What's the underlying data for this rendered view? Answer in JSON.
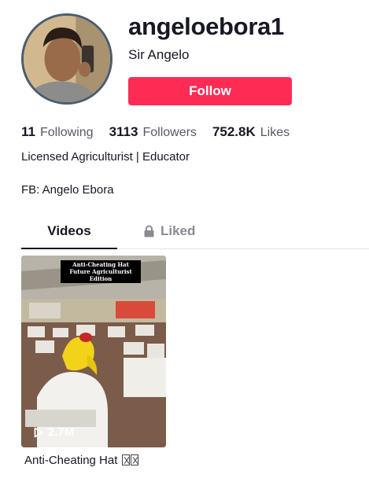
{
  "profile": {
    "username": "angeloebora1",
    "nickname": "Sir Angelo",
    "follow_label": "Follow",
    "avatar_icon": "avatar-photo"
  },
  "stats": {
    "following_count": "11",
    "following_label": "Following",
    "followers_count": "3113",
    "followers_label": "Followers",
    "likes_count": "752.8K",
    "likes_label": "Likes"
  },
  "bio": {
    "line1": "Licensed Agriculturist | Educator",
    "line2": "FB: Angelo Ebora"
  },
  "tabs": {
    "videos": "Videos",
    "liked": "Liked",
    "liked_icon": "lock-icon"
  },
  "videos": [
    {
      "overlay_line1": "Anti-Cheating Hat",
      "overlay_line2": "Future Agriculturist Edition",
      "views": "2.7M",
      "views_icon": "play-icon",
      "caption": "Anti-Cheating Hat"
    }
  ],
  "colors": {
    "follow_button": "#fe2c55",
    "text_primary": "#161823",
    "text_secondary": "#555a63",
    "tab_inactive": "#8a8b91"
  }
}
